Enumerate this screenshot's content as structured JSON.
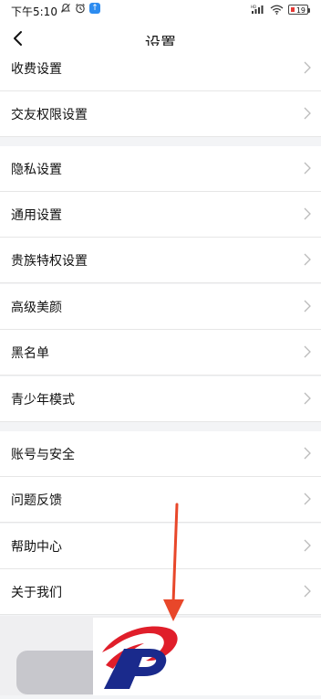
{
  "status_bar": {
    "time": "下午5:10",
    "battery": "19",
    "hd_label": "HD",
    "icons": [
      "mute-icon",
      "alarm-icon",
      "app-notify-icon",
      "signal-icon",
      "wifi-icon",
      "battery-icon"
    ]
  },
  "header": {
    "title": "设置"
  },
  "menu": {
    "group1": [
      {
        "label": "收费设置"
      },
      {
        "label": "交友权限设置"
      }
    ],
    "group2": [
      {
        "label": "隐私设置"
      },
      {
        "label": "通用设置"
      },
      {
        "label": "贵族特权设置"
      },
      {
        "label": "高级美颜"
      },
      {
        "label": "黑名单"
      },
      {
        "label": "青少年模式"
      }
    ],
    "group3": [
      {
        "label": "账号与安全"
      },
      {
        "label": "问题反馈"
      },
      {
        "label": "帮助中心"
      },
      {
        "label": "关于我们"
      }
    ]
  },
  "colors": {
    "arrow": "#e8472a",
    "logo_red": "#e01e2a",
    "logo_blue": "#1a2a8c"
  }
}
